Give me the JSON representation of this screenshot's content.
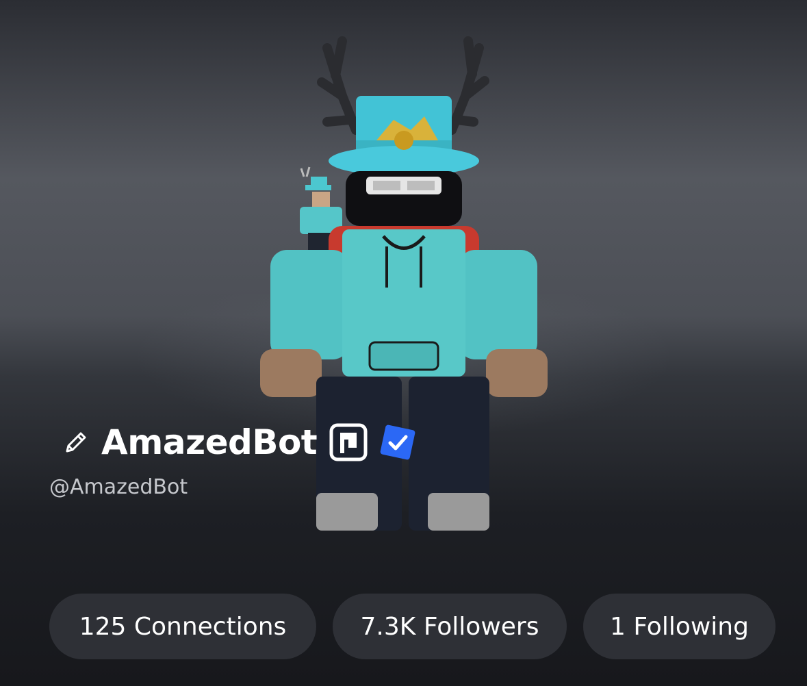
{
  "profile": {
    "display_name": "AmazedBot",
    "username": "@AmazedBot"
  },
  "badges": {
    "premium_icon": "premium-icon",
    "verified_icon": "verified-checkmark-icon",
    "verified_color": "#2b68f5"
  },
  "icons": {
    "edit_icon": "pencil-icon"
  },
  "stats": {
    "connections": "125 Connections",
    "followers": "7.3K Followers",
    "following": "1 Following"
  }
}
